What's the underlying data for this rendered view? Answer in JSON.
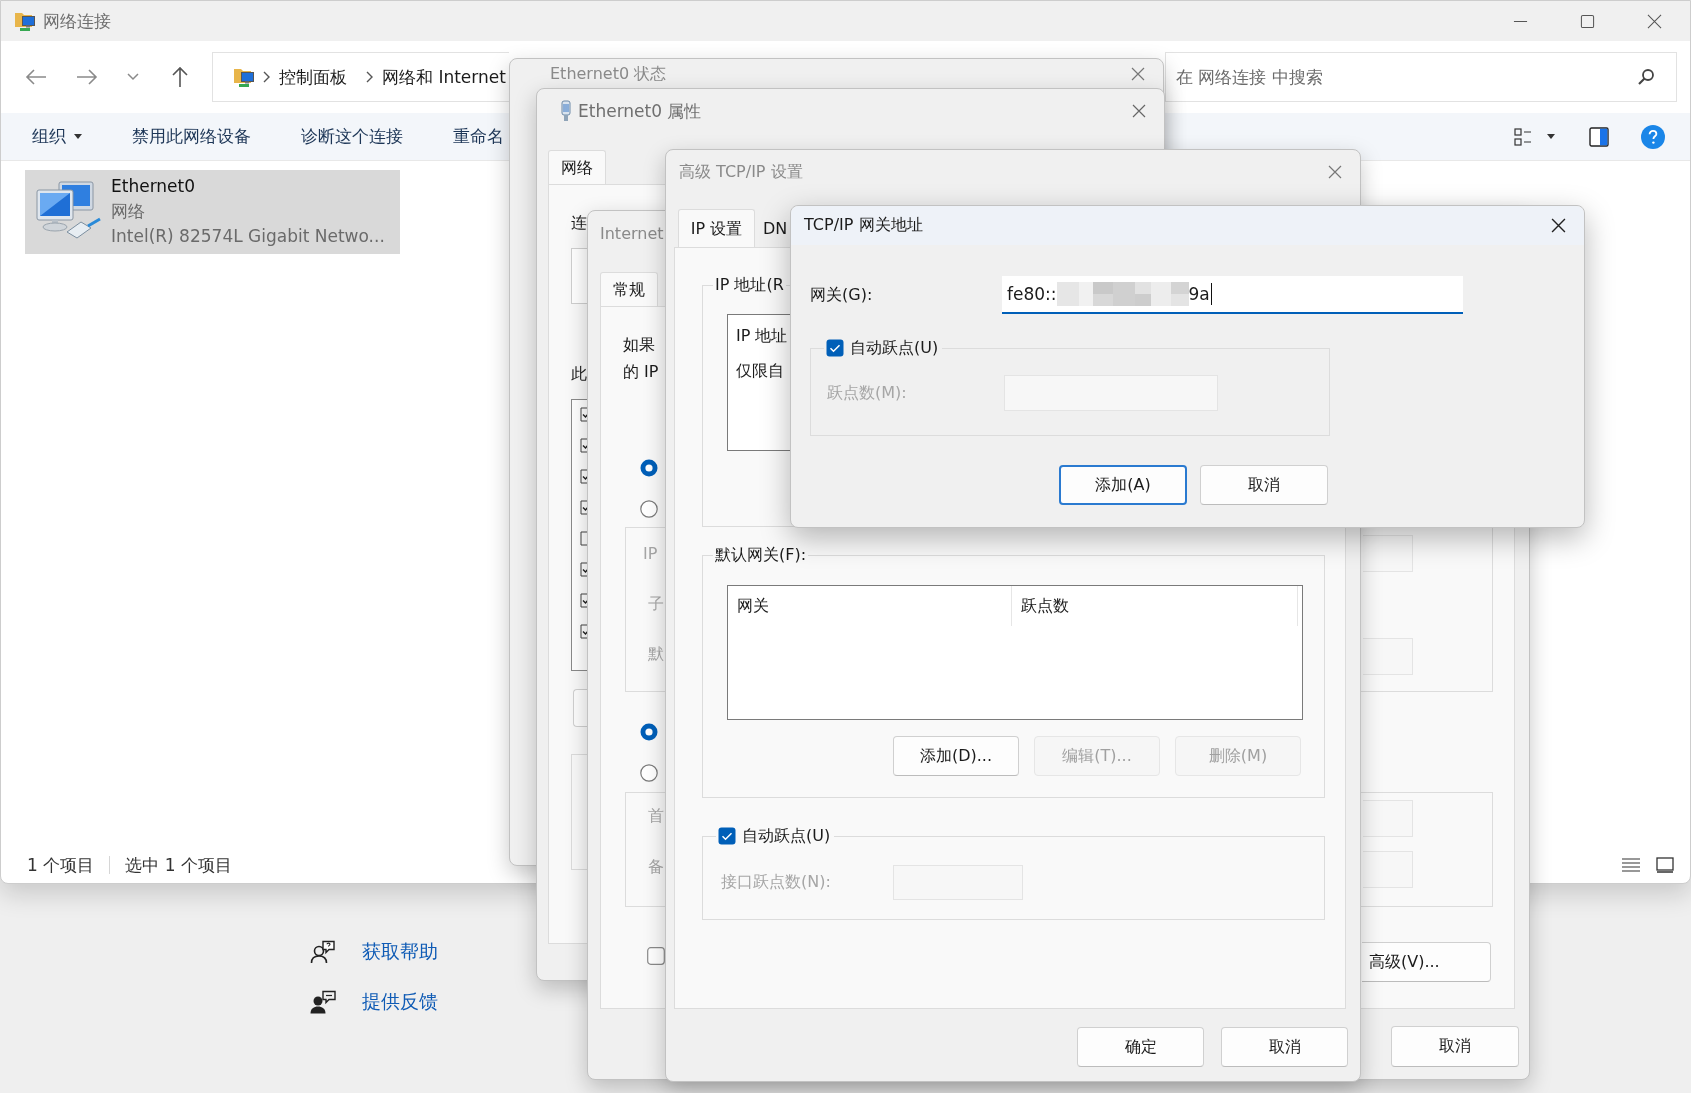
{
  "explorer": {
    "title": "网络连接",
    "breadcrumb": [
      "控制面板",
      "网络和 Internet"
    ],
    "search": {
      "placeholder": "在 网络连接 中搜索"
    },
    "toolbar": [
      {
        "label": "组织",
        "dropdown": true
      },
      {
        "label": "禁用此网络设备",
        "dropdown": false
      },
      {
        "label": "诊断这个连接",
        "dropdown": false
      },
      {
        "label": "重命名",
        "dropdown": false
      }
    ],
    "items": [
      {
        "name": "Ethernet0",
        "type": "网络",
        "device": "Intel(R) 82574L Gigabit Netwo...",
        "selected": true
      }
    ],
    "status_bar": {
      "count": "1 个项目",
      "selection": "选中 1 个项目"
    }
  },
  "help_links": [
    {
      "kind": "help",
      "label": "获取帮助"
    },
    {
      "kind": "feedback",
      "label": "提供反馈"
    }
  ],
  "status_dialog": {
    "title": "Ethernet0 状态"
  },
  "properties_dialog": {
    "title": "Ethernet0 属性",
    "tabs": [
      {
        "label": "网络",
        "selected": true
      }
    ],
    "connect_label": "连",
    "list_label": "此",
    "components": [
      {
        "checked": true
      },
      {
        "checked": true
      },
      {
        "checked": true
      },
      {
        "checked": true
      },
      {
        "checked": false
      },
      {
        "checked": true
      },
      {
        "checked": true
      },
      {
        "checked": true
      }
    ]
  },
  "ipv6_dialog": {
    "title": "Internet",
    "tabs": [
      {
        "label": "常规",
        "selected": true
      }
    ],
    "intro": [
      "如果",
      "的 IP"
    ],
    "radios": [
      {
        "selected": true
      },
      {
        "selected": false
      },
      {
        "selected": true
      },
      {
        "selected": false
      }
    ],
    "address_labels": [
      "IP",
      "子",
      "默"
    ],
    "dns_labels": [
      "首",
      "备"
    ],
    "validate_checked": false,
    "buttons": [
      {
        "kind": "advanced",
        "label": "高级(V)..."
      },
      {
        "kind": "cancel",
        "label": "取消"
      }
    ]
  },
  "advanced_dialog": {
    "title": "高级 TCP/IP 设置",
    "tabs": [
      {
        "label": "IP 设置",
        "selected": true
      },
      {
        "label": "DN",
        "selected": false
      }
    ],
    "ip_group": {
      "label": "IP 地址(R",
      "column": "IP 地址",
      "row": "仅限自"
    },
    "gateway_group": {
      "label": "默认网关(F):",
      "columns": [
        "网关",
        "跃点数"
      ],
      "buttons": [
        {
          "label": "添加(D)...",
          "disabled": false
        },
        {
          "label": "编辑(T)...",
          "disabled": true
        },
        {
          "label": "删除(M)",
          "disabled": true
        }
      ]
    },
    "auto_metric": {
      "label": "自动跃点(U)",
      "checked": true
    },
    "metric_label": "接口跃点数(N):",
    "buttons": [
      "确定",
      "取消"
    ]
  },
  "gateway_dialog": {
    "title": "TCP/IP 网关地址",
    "gateway_label": "网关(G):",
    "value_start": "fe80::",
    "value_end": "9a",
    "auto_metric": {
      "label": "自动跃点(U)",
      "checked": true
    },
    "metric_label": "跃点数(M):",
    "buttons": [
      {
        "label": "添加(A)",
        "default": true
      },
      {
        "label": "取消",
        "default": false
      }
    ]
  }
}
